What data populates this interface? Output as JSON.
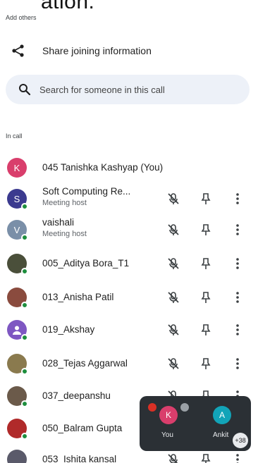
{
  "top_fragment": "ation.",
  "add_others_label": "Add others",
  "share": {
    "label": "Share joining information",
    "icon": "share-icon"
  },
  "search": {
    "placeholder": "Search for someone in this call",
    "icon": "search-icon"
  },
  "in_call_label": "In call",
  "participants": [
    {
      "name": "045 Tanishka Kashyap (You)",
      "subtitle": "",
      "avatar_letter": "K",
      "avatar_color": "#d93e6c",
      "present_dot": false,
      "actions": false
    },
    {
      "name": "Soft Computing Re...",
      "subtitle": "Meeting host",
      "avatar_letter": "S",
      "avatar_color": "#3b3a8f",
      "present_dot": true,
      "actions": true
    },
    {
      "name": "vaishali",
      "subtitle": "Meeting host",
      "avatar_letter": "V",
      "avatar_color": "#7a8fa8",
      "present_dot": true,
      "actions": true
    },
    {
      "name": "005_Aditya Bora_T1",
      "subtitle": "",
      "avatar_letter": "",
      "avatar_color": "#4a4f3a",
      "present_dot": true,
      "actions": true
    },
    {
      "name": "013_Anisha Patil",
      "subtitle": "",
      "avatar_letter": "",
      "avatar_color": "#8a4b3e",
      "present_dot": true,
      "actions": true
    },
    {
      "name": "019_Akshay",
      "subtitle": "",
      "avatar_letter": "",
      "avatar_color": "#7e57c2",
      "present_dot": true,
      "actions": true
    },
    {
      "name": "028_Tejas Aggarwal",
      "subtitle": "",
      "avatar_letter": "",
      "avatar_color": "#8a7a4e",
      "present_dot": true,
      "actions": true
    },
    {
      "name": "037_deepanshu",
      "subtitle": "",
      "avatar_letter": "",
      "avatar_color": "#6b5a4a",
      "present_dot": true,
      "actions": true
    },
    {
      "name": "050_Balram Gupta",
      "subtitle": "",
      "avatar_letter": "",
      "avatar_color": "#b02a2a",
      "present_dot": true,
      "actions": false
    },
    {
      "name": "053_Ishita kansal",
      "subtitle": "",
      "avatar_letter": "",
      "avatar_color": "#5a5a6a",
      "present_dot": false,
      "actions": true
    }
  ],
  "floating_panel": {
    "tiles": [
      {
        "letter": "K",
        "label": "You",
        "color": "#d93e6c"
      },
      {
        "letter": "A",
        "label": "Ankit",
        "color": "#12a4b8"
      }
    ],
    "extra_count": "+38"
  }
}
